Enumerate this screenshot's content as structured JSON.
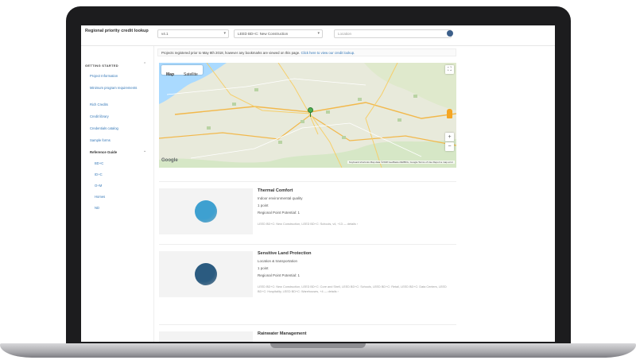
{
  "app": {
    "title": "Regional priority credit lookup"
  },
  "toolbar": {
    "version_select": "v4.1",
    "rating_select": "LEED BD+C: New Construction",
    "search_placeholder": "Location"
  },
  "notice": {
    "text": "Projects registered prior to May 8th 2018, however any bookmarks are viewed on this page.",
    "link": "Click here to view our credit lookup."
  },
  "sidebar": {
    "section1_header": "GETTING STARTED",
    "items": [
      "Project Information",
      "Minimum program requirements",
      "Rich Credits",
      "Credit library",
      "Credentials catalog",
      "Sample forms"
    ],
    "section2_header": "Reference Guide",
    "sub_items": [
      "BD+C",
      "ID+C",
      "O+M",
      "Homes",
      "ND"
    ]
  },
  "map": {
    "tabs": [
      "Map",
      "Satellite"
    ],
    "zoom_in": "+",
    "zoom_out": "−",
    "fullscreen": "⛶",
    "logo": "Google",
    "footer": "Keyboard shortcuts   Map data ©2018 GeoBasis-DE/BKG, Google   Terms of Use   Report a map error"
  },
  "cards": [
    {
      "title": "Thermal Comfort",
      "line1": "Indoor environmental quality",
      "line2": "1 point",
      "line3": "Regional Point Potential: 1",
      "meta": "LEED BD+C: New Construction, LEED BD+C: Schools, v4, +13 — details ›",
      "color": "#3ea0d0"
    },
    {
      "title": "Sensitive Land Protection",
      "line1": "Location & transportation",
      "line2": "1 point",
      "line3": "Regional Point Potential: 1",
      "meta": "LEED BD+C: New Construction, LEED BD+C: Core and Shell, LEED BD+C: Schools, LEED BD+C: Retail, LEED BD+C: Data Centers, LEED BD+C: Hospitality, LEED BD+C: Warehouses, +4 — details ›",
      "color": "#2b5b80"
    },
    {
      "title": "Rainwater Management",
      "line1": "",
      "line2": "",
      "line3": "",
      "meta": "",
      "color": "#3ea0d0"
    }
  ]
}
